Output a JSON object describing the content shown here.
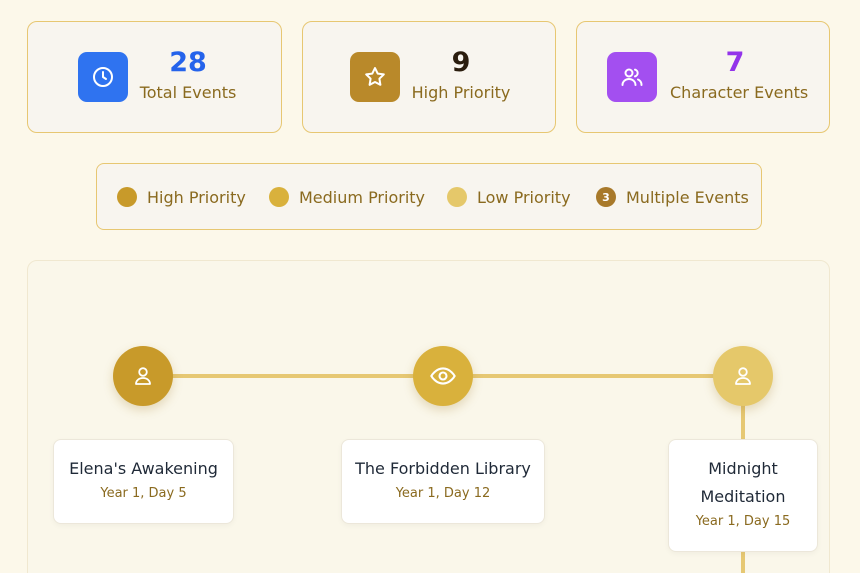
{
  "stats": [
    {
      "value": "28",
      "label": "Total Events",
      "icon": "clock-icon",
      "color": "#2563eb",
      "icon_bg": "#2f73f0"
    },
    {
      "value": "9",
      "label": "High Priority",
      "icon": "star-icon",
      "color": "#2b1d0e",
      "icon_bg": "#b9892a"
    },
    {
      "value": "7",
      "label": "Character Events",
      "icon": "users-icon",
      "color": "#9333ea",
      "icon_bg": "#a34ff0"
    }
  ],
  "legend": [
    {
      "label": "High Priority",
      "color": "#c89a2a"
    },
    {
      "label": "Medium Priority",
      "color": "#d9b13c"
    },
    {
      "label": "Low Priority",
      "color": "#e5c86a"
    },
    {
      "label": "Multiple Events",
      "color": "#a8792a",
      "badge": "3"
    }
  ],
  "events": [
    {
      "title": "Elena's Awakening",
      "date": "Year 1, Day 5",
      "icon": "user-icon",
      "color": "#c89a2a"
    },
    {
      "title": "The Forbidden Library",
      "date": "Year 1, Day 12",
      "icon": "eye-icon",
      "color": "#d9b13c"
    },
    {
      "title": "Midnight Meditation",
      "date": "Year 1, Day 15",
      "icon": "user-icon",
      "color": "#e5c86a"
    }
  ]
}
